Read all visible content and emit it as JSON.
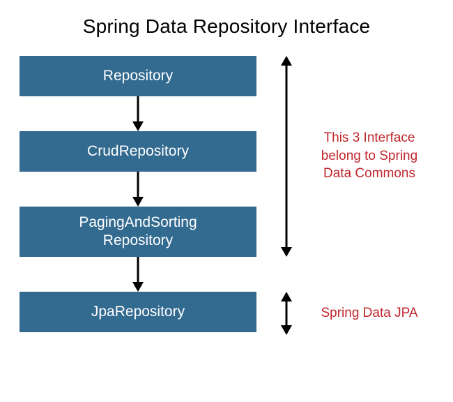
{
  "title": "Spring Data Repository Interface",
  "boxes": {
    "repository": "Repository",
    "crud": "CrudRepository",
    "paging_line1": "PagingAndSorting",
    "paging_line2": "Repository",
    "jpa": "JpaRepository"
  },
  "annotations": {
    "top": "This 3 Interface belong to Spring Data Commons",
    "bottom": "Spring Data JPA"
  },
  "colors": {
    "box_bg": "#336a90",
    "box_text": "#ffffff",
    "annotation_text": "#c0272d",
    "title_text": "#000000"
  }
}
